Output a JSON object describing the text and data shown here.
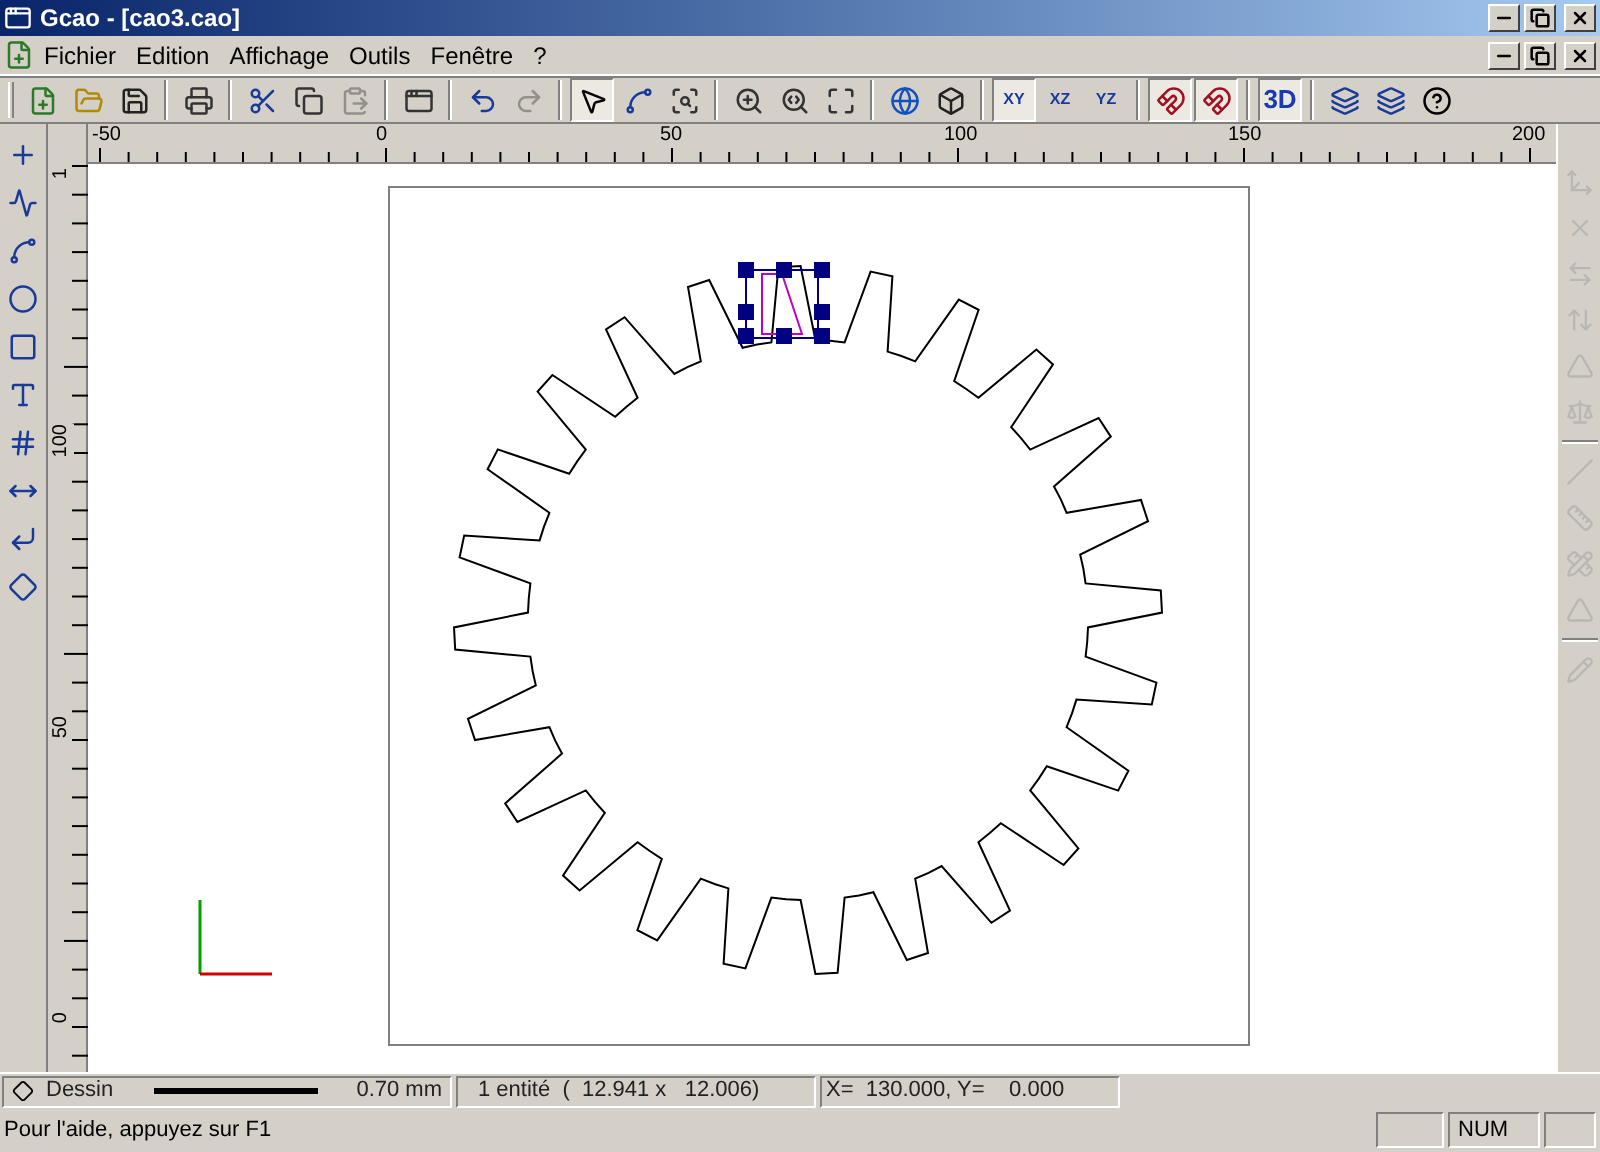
{
  "window": {
    "title": "Gcao - [cao3.cao]"
  },
  "menu": [
    {
      "label": "Fichier"
    },
    {
      "label": "Edition"
    },
    {
      "label": "Affichage"
    },
    {
      "label": "Outils"
    },
    {
      "label": "Fenêtre"
    },
    {
      "label": "?"
    }
  ],
  "toolbar": [
    {
      "kind": "new",
      "selected": false,
      "disabled": false
    },
    {
      "kind": "open",
      "selected": false,
      "disabled": false
    },
    {
      "kind": "save",
      "selected": false,
      "disabled": false
    },
    {
      "kind": "sep"
    },
    {
      "kind": "print",
      "selected": false,
      "disabled": false
    },
    {
      "kind": "sep"
    },
    {
      "kind": "cut",
      "selected": false,
      "disabled": false
    },
    {
      "kind": "copy",
      "selected": false,
      "disabled": false
    },
    {
      "kind": "paste",
      "selected": false,
      "disabled": true
    },
    {
      "kind": "sep"
    },
    {
      "kind": "window",
      "selected": false,
      "disabled": false
    },
    {
      "kind": "sep"
    },
    {
      "kind": "undo",
      "selected": false,
      "disabled": false
    },
    {
      "kind": "redo",
      "selected": false,
      "disabled": true
    },
    {
      "kind": "sep"
    },
    {
      "kind": "select",
      "selected": true,
      "disabled": false
    },
    {
      "kind": "edit-curve",
      "selected": false,
      "disabled": false
    },
    {
      "kind": "zoom-window",
      "selected": false,
      "disabled": false
    },
    {
      "kind": "sep"
    },
    {
      "kind": "zoom",
      "selected": false,
      "disabled": false
    },
    {
      "kind": "zoom-previous",
      "selected": false,
      "disabled": false
    },
    {
      "kind": "zoom-all",
      "selected": false,
      "disabled": false
    },
    {
      "kind": "sep"
    },
    {
      "kind": "sphere",
      "selected": false,
      "disabled": false
    },
    {
      "kind": "cube",
      "selected": false,
      "disabled": false
    },
    {
      "kind": "sep"
    },
    {
      "kind": "plane",
      "label": "XY",
      "selected": true,
      "disabled": false
    },
    {
      "kind": "plane",
      "label": "XZ",
      "selected": false,
      "disabled": false
    },
    {
      "kind": "plane",
      "label": "YZ",
      "selected": false,
      "disabled": false
    },
    {
      "kind": "sep"
    },
    {
      "kind": "snap-grid",
      "selected": true,
      "disabled": false
    },
    {
      "kind": "snap-perpendicular",
      "selected": true,
      "disabled": false
    },
    {
      "kind": "sep"
    },
    {
      "kind": "text",
      "label": "3D",
      "selected": true,
      "disabled": false
    },
    {
      "kind": "sep"
    },
    {
      "kind": "fab",
      "selected": false,
      "disabled": false
    },
    {
      "kind": "fab",
      "selected": false,
      "disabled": false
    },
    {
      "kind": "help",
      "selected": false,
      "disabled": false
    }
  ],
  "left_tools": [
    {
      "kind": "points"
    },
    {
      "kind": "polyline"
    },
    {
      "kind": "curve"
    },
    {
      "kind": "circle"
    },
    {
      "kind": "rectangle"
    },
    {
      "kind": "text"
    },
    {
      "kind": "hatch"
    },
    {
      "kind": "dimension"
    },
    {
      "kind": "fillet"
    },
    {
      "kind": "transform"
    }
  ],
  "right_tools": [
    {
      "kind": "a",
      "disabled": true
    },
    {
      "kind": "b",
      "disabled": true
    },
    {
      "kind": "c",
      "disabled": true
    },
    {
      "kind": "d",
      "disabled": true
    },
    {
      "kind": "e",
      "disabled": true
    },
    {
      "kind": "f",
      "disabled": true
    },
    {
      "kind": "sep"
    },
    {
      "kind": "g",
      "disabled": true
    },
    {
      "kind": "h",
      "disabled": true
    },
    {
      "kind": "i",
      "disabled": true
    },
    {
      "kind": "j",
      "disabled": true
    },
    {
      "kind": "sep"
    },
    {
      "kind": "k",
      "disabled": true
    }
  ],
  "ruler_h": {
    "labels": [
      "-50",
      "0",
      "50",
      "100",
      "150",
      "200"
    ]
  },
  "ruler_v": {
    "labels": [
      "1",
      "100",
      "50",
      "0"
    ]
  },
  "status_bar": {
    "mode": "Dessin",
    "line_width": "0.70 mm",
    "selection": "1 entité  (  12.941 x   12.006)",
    "coordinates": "X=  130.000, Y=    0.000"
  },
  "help_bar": {
    "text": "Pour l'aide, appuyez sur F1",
    "num_indicator": "NUM"
  }
}
